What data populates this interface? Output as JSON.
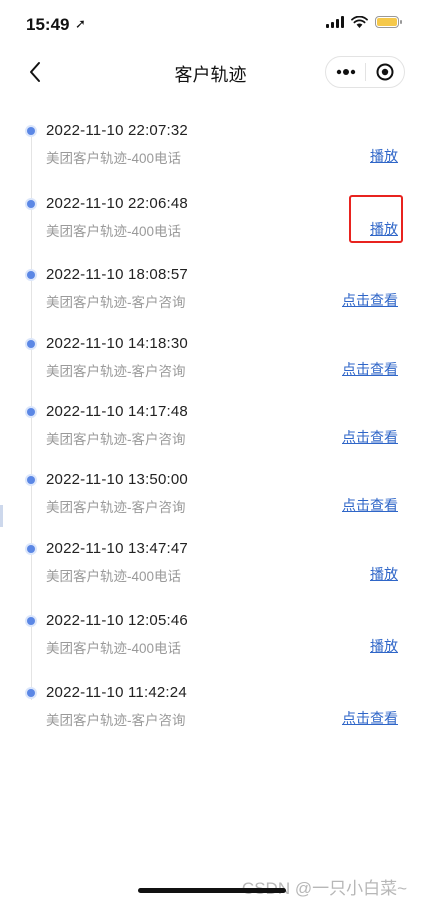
{
  "status_bar": {
    "time": "15:49",
    "location_glyph": "➚",
    "battery_color": "#f5c84a"
  },
  "nav": {
    "title": "客户轨迹",
    "more_glyph": "•••"
  },
  "timeline": {
    "accent_color": "#5b87e5",
    "link_color": "#2f66c8",
    "items": [
      {
        "time": "2022-11-10 22:07:32",
        "desc": "美团客户轨迹-400电话",
        "action": "播放"
      },
      {
        "time": "2022-11-10 22:06:48",
        "desc": "美团客户轨迹-400电话",
        "action": "播放"
      },
      {
        "time": "2022-11-10 18:08:57",
        "desc": "美团客户轨迹-客户咨询",
        "action": "点击查看"
      },
      {
        "time": "2022-11-10 14:18:30",
        "desc": "美团客户轨迹-客户咨询",
        "action": "点击查看"
      },
      {
        "time": "2022-11-10 14:17:48",
        "desc": "美团客户轨迹-客户咨询",
        "action": "点击查看"
      },
      {
        "time": "2022-11-10 13:50:00",
        "desc": "美团客户轨迹-客户咨询",
        "action": "点击查看"
      },
      {
        "time": "2022-11-10 13:47:47",
        "desc": "美团客户轨迹-400电话",
        "action": "播放"
      },
      {
        "time": "2022-11-10 12:05:46",
        "desc": "美团客户轨迹-400电话",
        "action": "播放"
      },
      {
        "time": "2022-11-10 11:42:24",
        "desc": "美团客户轨迹-客户咨询",
        "action": "点击查看"
      }
    ]
  },
  "annotation": {
    "highlight_color": "#e8231f"
  },
  "watermark": "CSDN @一只小白菜~"
}
